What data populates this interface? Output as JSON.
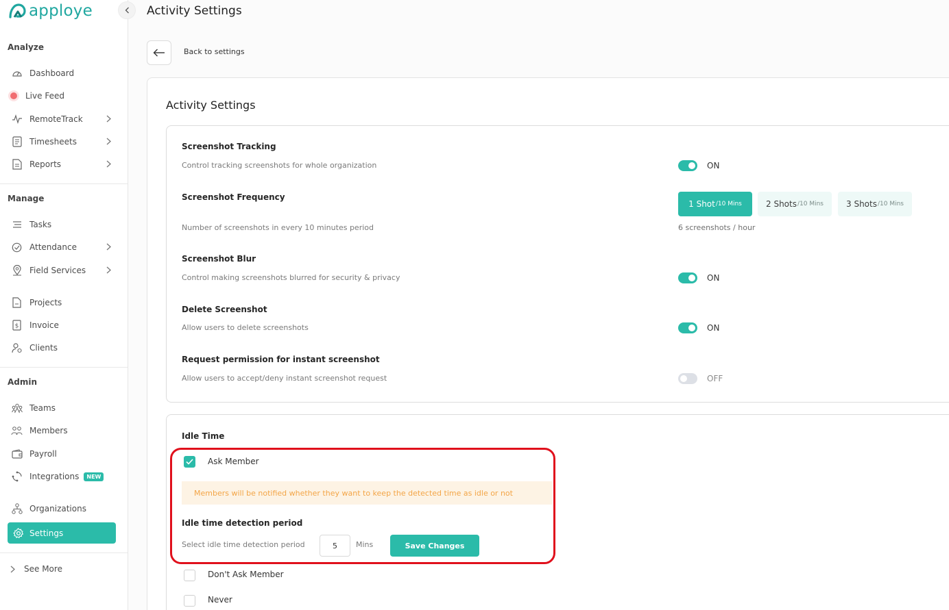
{
  "brand": {
    "name": "apploye",
    "accent": "#2bbba9"
  },
  "sidebar": {
    "sections": {
      "analyze": "Analyze",
      "manage": "Manage",
      "admin": "Admin"
    },
    "analyze": [
      {
        "label": "Dashboard",
        "icon": "dashboard-icon"
      },
      {
        "label": "Live Feed",
        "icon": "live-dot-icon"
      },
      {
        "label": "RemoteTrack",
        "icon": "pulse-icon"
      },
      {
        "label": "Timesheets",
        "icon": "timesheet-icon"
      },
      {
        "label": "Reports",
        "icon": "report-icon"
      }
    ],
    "manage": [
      {
        "label": "Tasks",
        "icon": "tasks-icon"
      },
      {
        "label": "Attendance",
        "icon": "attendance-icon"
      },
      {
        "label": "Field Services",
        "icon": "location-icon"
      },
      {
        "label": "Projects",
        "icon": "project-icon"
      },
      {
        "label": "Invoice",
        "icon": "invoice-icon"
      },
      {
        "label": "Clients",
        "icon": "client-icon"
      }
    ],
    "admin": [
      {
        "label": "Teams",
        "icon": "teams-icon"
      },
      {
        "label": "Members",
        "icon": "members-icon"
      },
      {
        "label": "Payroll",
        "icon": "wallet-icon"
      },
      {
        "label": "Integrations",
        "icon": "integrations-icon",
        "badge": "NEW"
      },
      {
        "label": "Organizations",
        "icon": "organization-icon"
      },
      {
        "label": "Settings",
        "icon": "gear-icon",
        "active": true
      }
    ],
    "see_more": "See More"
  },
  "header": {
    "title": "Activity Settings",
    "back_label": "Back to settings"
  },
  "panel": {
    "title": "Activity Settings",
    "screenshot_tracking": {
      "title": "Screenshot Tracking",
      "desc": "Control tracking screenshots for whole organization",
      "state": "ON"
    },
    "screenshot_frequency": {
      "title": "Screenshot Frequency",
      "desc": "Number of screenshots in every 10 minutes period",
      "options": [
        {
          "main": "1 Shot",
          "sub": "/10 Mins",
          "active": true
        },
        {
          "main": "2 Shots",
          "sub": "/10 Mins"
        },
        {
          "main": "3 Shots",
          "sub": "/10 Mins"
        }
      ],
      "note": "6 screenshots / hour"
    },
    "screenshot_blur": {
      "title": "Screenshot Blur",
      "desc": "Control making screenshots blurred for security & privacy",
      "state": "ON"
    },
    "delete_screenshot": {
      "title": "Delete Screenshot",
      "desc": "Allow users to delete screenshots",
      "state": "ON"
    },
    "instant_screenshot": {
      "title": "Request permission for instant screenshot",
      "desc": "Allow users to accept/deny instant screenshot request",
      "state": "OFF"
    }
  },
  "idle": {
    "title": "Idle Time",
    "ask_member": "Ask Member",
    "notice": "Members will be notified whether they want to keep the detected time as idle or not",
    "period_title": "Idle time detection period",
    "period_label": "Select idle time detection period",
    "period_value": "5",
    "period_unit": "Mins",
    "save_label": "Save Changes",
    "dont_ask": "Don't Ask Member",
    "never": "Never"
  }
}
